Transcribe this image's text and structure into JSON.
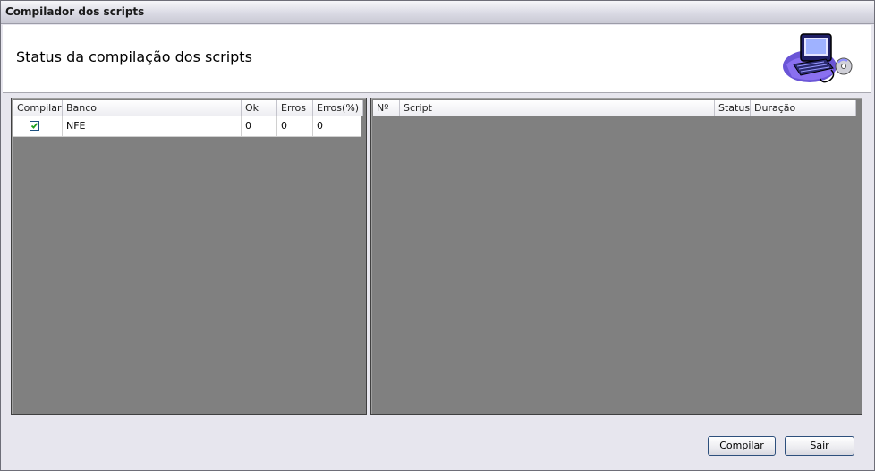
{
  "window": {
    "title": "Compilador dos scripts"
  },
  "header": {
    "heading": "Status da compilação dos scripts",
    "icon": "computer-icon"
  },
  "databases": {
    "columns": [
      "Compilar",
      "Banco",
      "Ok",
      "Erros",
      "Erros(%)"
    ],
    "rows": [
      {
        "compile": true,
        "bank": "NFE",
        "ok": "0",
        "errors": "0",
        "errors_pct": "0"
      }
    ]
  },
  "scripts": {
    "columns": [
      "Nº",
      "Script",
      "Status",
      "Duração"
    ],
    "rows": []
  },
  "buttons": {
    "compile": "Compilar",
    "exit": "Sair"
  },
  "colors": {
    "grid_background": "#808080",
    "window_background": "#e7e6ee",
    "check_color": "#21a121"
  }
}
